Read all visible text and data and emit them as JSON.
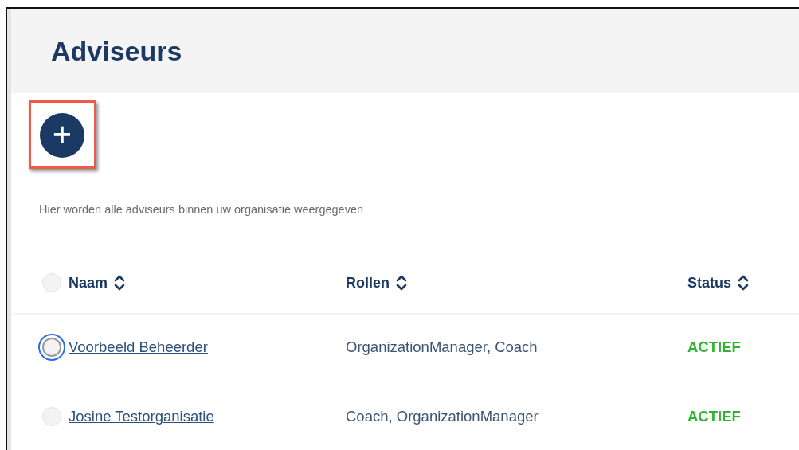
{
  "page": {
    "title": "Adviseurs"
  },
  "add_button": {
    "label": "+",
    "highlighted": true
  },
  "description": "Hier worden alle adviseurs binnen uw organisatie weergegeven",
  "table": {
    "select_all": {
      "checked": false
    },
    "columns": [
      "Naam",
      "Rollen",
      "Status"
    ],
    "rows": [
      {
        "name": "Voorbeeld Beheerder",
        "roles": "OrganizationManager, Coach",
        "status": "ACTIEF",
        "selected": false,
        "focused": true
      },
      {
        "name": "Josine Testorganisatie",
        "roles": "Coach, OrganizationManager",
        "status": "ACTIEF",
        "selected": false,
        "focused": false
      }
    ]
  }
}
